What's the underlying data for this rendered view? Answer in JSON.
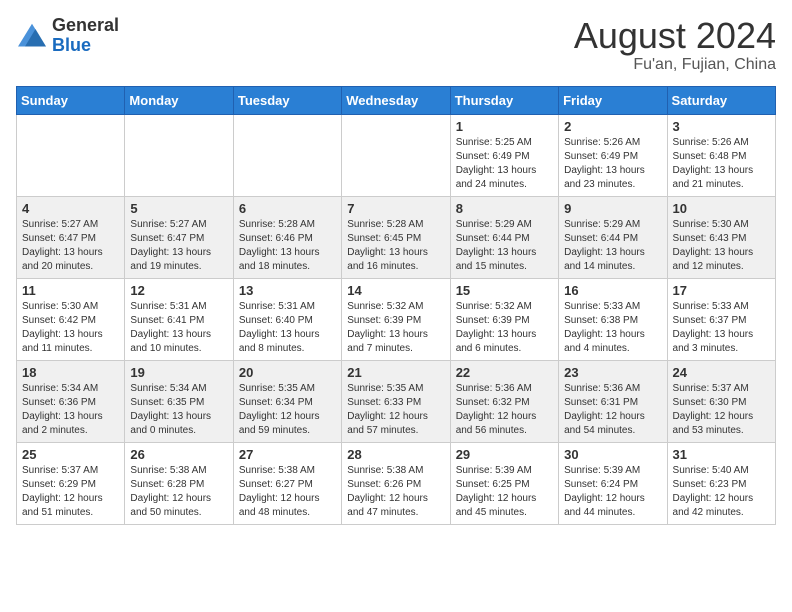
{
  "header": {
    "logo_general": "General",
    "logo_blue": "Blue",
    "month_year": "August 2024",
    "location": "Fu'an, Fujian, China"
  },
  "weekdays": [
    "Sunday",
    "Monday",
    "Tuesday",
    "Wednesday",
    "Thursday",
    "Friday",
    "Saturday"
  ],
  "weeks": [
    [
      {
        "day": "",
        "info": ""
      },
      {
        "day": "",
        "info": ""
      },
      {
        "day": "",
        "info": ""
      },
      {
        "day": "",
        "info": ""
      },
      {
        "day": "1",
        "info": "Sunrise: 5:25 AM\nSunset: 6:49 PM\nDaylight: 13 hours\nand 24 minutes."
      },
      {
        "day": "2",
        "info": "Sunrise: 5:26 AM\nSunset: 6:49 PM\nDaylight: 13 hours\nand 23 minutes."
      },
      {
        "day": "3",
        "info": "Sunrise: 5:26 AM\nSunset: 6:48 PM\nDaylight: 13 hours\nand 21 minutes."
      }
    ],
    [
      {
        "day": "4",
        "info": "Sunrise: 5:27 AM\nSunset: 6:47 PM\nDaylight: 13 hours\nand 20 minutes."
      },
      {
        "day": "5",
        "info": "Sunrise: 5:27 AM\nSunset: 6:47 PM\nDaylight: 13 hours\nand 19 minutes."
      },
      {
        "day": "6",
        "info": "Sunrise: 5:28 AM\nSunset: 6:46 PM\nDaylight: 13 hours\nand 18 minutes."
      },
      {
        "day": "7",
        "info": "Sunrise: 5:28 AM\nSunset: 6:45 PM\nDaylight: 13 hours\nand 16 minutes."
      },
      {
        "day": "8",
        "info": "Sunrise: 5:29 AM\nSunset: 6:44 PM\nDaylight: 13 hours\nand 15 minutes."
      },
      {
        "day": "9",
        "info": "Sunrise: 5:29 AM\nSunset: 6:44 PM\nDaylight: 13 hours\nand 14 minutes."
      },
      {
        "day": "10",
        "info": "Sunrise: 5:30 AM\nSunset: 6:43 PM\nDaylight: 13 hours\nand 12 minutes."
      }
    ],
    [
      {
        "day": "11",
        "info": "Sunrise: 5:30 AM\nSunset: 6:42 PM\nDaylight: 13 hours\nand 11 minutes."
      },
      {
        "day": "12",
        "info": "Sunrise: 5:31 AM\nSunset: 6:41 PM\nDaylight: 13 hours\nand 10 minutes."
      },
      {
        "day": "13",
        "info": "Sunrise: 5:31 AM\nSunset: 6:40 PM\nDaylight: 13 hours\nand 8 minutes."
      },
      {
        "day": "14",
        "info": "Sunrise: 5:32 AM\nSunset: 6:39 PM\nDaylight: 13 hours\nand 7 minutes."
      },
      {
        "day": "15",
        "info": "Sunrise: 5:32 AM\nSunset: 6:39 PM\nDaylight: 13 hours\nand 6 minutes."
      },
      {
        "day": "16",
        "info": "Sunrise: 5:33 AM\nSunset: 6:38 PM\nDaylight: 13 hours\nand 4 minutes."
      },
      {
        "day": "17",
        "info": "Sunrise: 5:33 AM\nSunset: 6:37 PM\nDaylight: 13 hours\nand 3 minutes."
      }
    ],
    [
      {
        "day": "18",
        "info": "Sunrise: 5:34 AM\nSunset: 6:36 PM\nDaylight: 13 hours\nand 2 minutes."
      },
      {
        "day": "19",
        "info": "Sunrise: 5:34 AM\nSunset: 6:35 PM\nDaylight: 13 hours\nand 0 minutes."
      },
      {
        "day": "20",
        "info": "Sunrise: 5:35 AM\nSunset: 6:34 PM\nDaylight: 12 hours\nand 59 minutes."
      },
      {
        "day": "21",
        "info": "Sunrise: 5:35 AM\nSunset: 6:33 PM\nDaylight: 12 hours\nand 57 minutes."
      },
      {
        "day": "22",
        "info": "Sunrise: 5:36 AM\nSunset: 6:32 PM\nDaylight: 12 hours\nand 56 minutes."
      },
      {
        "day": "23",
        "info": "Sunrise: 5:36 AM\nSunset: 6:31 PM\nDaylight: 12 hours\nand 54 minutes."
      },
      {
        "day": "24",
        "info": "Sunrise: 5:37 AM\nSunset: 6:30 PM\nDaylight: 12 hours\nand 53 minutes."
      }
    ],
    [
      {
        "day": "25",
        "info": "Sunrise: 5:37 AM\nSunset: 6:29 PM\nDaylight: 12 hours\nand 51 minutes."
      },
      {
        "day": "26",
        "info": "Sunrise: 5:38 AM\nSunset: 6:28 PM\nDaylight: 12 hours\nand 50 minutes."
      },
      {
        "day": "27",
        "info": "Sunrise: 5:38 AM\nSunset: 6:27 PM\nDaylight: 12 hours\nand 48 minutes."
      },
      {
        "day": "28",
        "info": "Sunrise: 5:38 AM\nSunset: 6:26 PM\nDaylight: 12 hours\nand 47 minutes."
      },
      {
        "day": "29",
        "info": "Sunrise: 5:39 AM\nSunset: 6:25 PM\nDaylight: 12 hours\nand 45 minutes."
      },
      {
        "day": "30",
        "info": "Sunrise: 5:39 AM\nSunset: 6:24 PM\nDaylight: 12 hours\nand 44 minutes."
      },
      {
        "day": "31",
        "info": "Sunrise: 5:40 AM\nSunset: 6:23 PM\nDaylight: 12 hours\nand 42 minutes."
      }
    ]
  ]
}
